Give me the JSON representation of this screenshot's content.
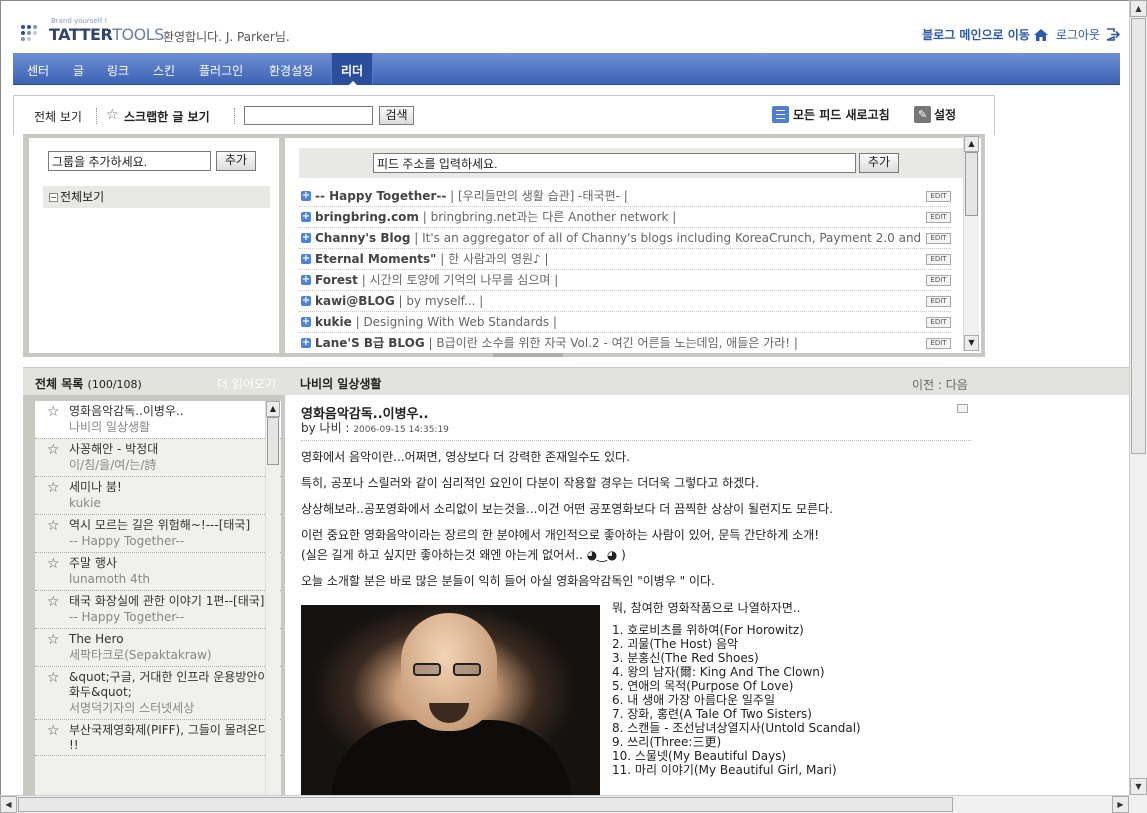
{
  "header": {
    "logo_sub": "Brand yourself !",
    "logo_main": "TATTER",
    "logo_main2": "TOOLS",
    "welcome": "환영합니다. J. Parker님.",
    "blog_main_link": "블로그 메인으로 이동",
    "logout_link": "로그아웃"
  },
  "nav": {
    "items": [
      "센터",
      "글",
      "링크",
      "스킨",
      "플러그인",
      "환경설정"
    ],
    "active": "리더"
  },
  "toolbar": {
    "view_all": "전체 보기",
    "scrap_view": "스크랩한 글 보기",
    "search_value": "",
    "search_button": "검색",
    "refresh_all": "모든 피드 새로고침",
    "settings": "설정"
  },
  "groups": {
    "input_value": "그룹을 추가하세요.",
    "add_button": "추가",
    "all_label": "전체보기"
  },
  "feeds": {
    "input_value": "피드 주소를 입력하세요.",
    "add_button": "추가",
    "edit_label": "EDIT",
    "items": [
      {
        "title": "-- Happy Together--",
        "desc": " | [우리들만의 생활 습관] -태국편- |"
      },
      {
        "title": "bringbring.com",
        "desc": " | bringbring.net과는 다른 Another network |"
      },
      {
        "title": "Channy's Blog",
        "desc": " | It's an aggregator of all of Channy's blogs including KoreaCrunch, Payment 2.0 and"
      },
      {
        "title": "Eternal Moments\"",
        "desc": " | 한 사람과의 영원♪ |"
      },
      {
        "title": "Forest",
        "desc": " | 시간의 토양에 기억의 나무를 심으며 |"
      },
      {
        "title": "kawi@BLOG",
        "desc": " | by myself... |"
      },
      {
        "title": "kukie",
        "desc": " | Designing With Web Standards |"
      },
      {
        "title": "Lane'S B급 BLOG",
        "desc": " | B급이란 소수를 위한 자국 Vol.2 - 여긴 어른들 노는데임, 애들은 가라! |"
      }
    ]
  },
  "lower_bar": {
    "list_title": "전체 목록",
    "list_count": "(100/108)",
    "more": "더 읽어오기",
    "blog_name": "나비의 일상생활",
    "prev_next": "이전 : 다음"
  },
  "entries": [
    {
      "title": "영화음악감독..이병우..",
      "source": "나비의 일상생활"
    },
    {
      "title": "사꽁해안 - 박정대",
      "source": "이/침/을/여/는/詩"
    },
    {
      "title": "세미나 붐!",
      "source": "kukie"
    },
    {
      "title": "역시 모르는 길은 위험해~!---[태국]",
      "source": "-- Happy Together--"
    },
    {
      "title": "주말 행사",
      "source": "lunamoth 4th"
    },
    {
      "title": "태국 화장실에 관한 이야기 1편--[태국]",
      "source": "-- Happy Together--"
    },
    {
      "title": "The Hero",
      "source": "세팍타크로(Sepaktakraw)"
    },
    {
      "title": "&quot;구글, 거대한 인프라 운용방안이 화두&quot;",
      "source": "서명덕기자의 스터넷세상"
    },
    {
      "title": "부산국제영화제(PIFF), 그들이 몰려온다 !!",
      "source": ""
    }
  ],
  "article": {
    "title": "영화음악감독..이병우..",
    "by": "by 나비 :",
    "date": "2006-09-15 14:35:19",
    "paragraphs": [
      "영화에서 음악이란...어쩌면, 영상보다 더 강력한 존재일수도 있다.",
      "특히, 공포나 스릴러와 같이 심리적인 요인이 다분이 작용할 경우는 더더욱 그렇다고 하겠다.",
      "상상해보라..공포영화에서 소리없이 보는것을...이건 어떤 공포영화보다 더 끔찍한 상상이 될런지도 모른다.",
      "이런 중요한 영화음악이라는 장르의 한 분야에서 개인적으로 좋아하는 사람이 있어, 문득 간단하게 소개!",
      "(실은 길게 하고 싶지만 좋아하는것 왜엔 아는게 없어서.. ◕‿◕ )",
      "오늘 소개할 분은 바로 많은 분들이 익히 들어 아실 영화음악감독인 \"이병우   \" 이다."
    ],
    "works_intro": "뭐, 참여한 영화작품으로 나열하자면..",
    "works": [
      "1. 호로비츠를 위하여(For Horowitz)",
      "2. 괴물(The Host) 음악",
      "3. 분홍신(The Red Shoes)",
      "4. 왕의 남자(爾: King And The Clown)",
      "5. 연애의 목적(Purpose Of Love)",
      "6. 내 생애 가장 아름다운 일주일",
      "7. 장화, 홍련(A Tale Of Two Sisters)",
      "8. 스캔들 - 조선남녀상열지사(Untold Scandal)",
      "9. 쓰리(Three:三更)",
      "10. 스물넷(My Beautiful Days)",
      "11. 마리 이야기(My Beautiful Girl, Mari)"
    ]
  }
}
